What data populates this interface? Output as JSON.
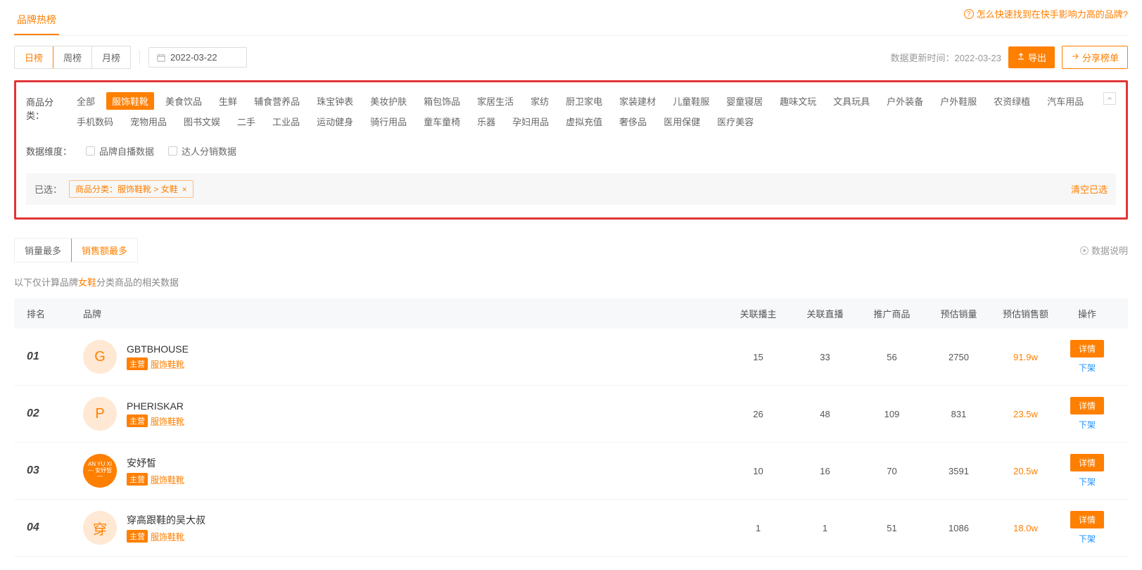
{
  "header": {
    "tab": "品牌热榜",
    "help": "怎么快速找到在快手影响力高的品牌?"
  },
  "toolbar": {
    "periods": [
      "日榜",
      "周榜",
      "月榜"
    ],
    "period_active_index": 0,
    "date": "2022-03-22",
    "update_prefix": "数据更新时间：",
    "update_time": "2022-03-23",
    "export": "导出",
    "share": "分享榜单"
  },
  "filters": {
    "category_label": "商品分类：",
    "category_active_index": 1,
    "categories": [
      "全部",
      "服饰鞋靴",
      "美食饮品",
      "生鲜",
      "辅食营养品",
      "珠宝钟表",
      "美妆护肤",
      "箱包饰品",
      "家居生活",
      "家纺",
      "厨卫家电",
      "家装建材",
      "儿童鞋服",
      "婴童寝居",
      "趣味文玩",
      "文具玩具",
      "户外装备",
      "户外鞋服",
      "农资绿植",
      "汽车用品",
      "手机数码",
      "宠物用品",
      "图书文娱",
      "二手",
      "工业品",
      "运动健身",
      "骑行用品",
      "童车童椅",
      "乐器",
      "孕妇用品",
      "虚拟充值",
      "奢侈品",
      "医用保健",
      "医疗美容"
    ],
    "dim_label": "数据维度：",
    "dim_options": [
      "品牌自播数据",
      "达人分销数据"
    ],
    "selected_label": "已选：",
    "selected_chip": "商品分类：服饰鞋靴 > 女鞋",
    "clear": "清空已选"
  },
  "sort": {
    "tabs": [
      "销量最多",
      "销售额最多"
    ],
    "active_index": 1,
    "data_desc": "数据说明"
  },
  "note": {
    "pre": "以下仅计算品牌",
    "hl": "女鞋",
    "post": "分类商品的相关数据"
  },
  "table": {
    "headers": {
      "rank": "排名",
      "brand": "品牌",
      "broadcaster": "关联播主",
      "live": "关联直播",
      "product": "推广商品",
      "volume": "预估销量",
      "sales": "预估销售额",
      "action": "操作"
    },
    "tag_main": "主营",
    "tag_cat": "服饰鞋靴",
    "btn_detail": "详情",
    "link_off": "下架",
    "rows": [
      {
        "rank": "01",
        "logo": "G",
        "logo_class": "",
        "name": "GBTBHOUSE",
        "broadcaster": "15",
        "live": "33",
        "product": "56",
        "volume": "2750",
        "sales": "91.9w"
      },
      {
        "rank": "02",
        "logo": "P",
        "logo_class": "",
        "name": "PHERISKAR",
        "broadcaster": "26",
        "live": "48",
        "product": "109",
        "volume": "831",
        "sales": "23.5w"
      },
      {
        "rank": "03",
        "logo": "AN YU XI\n— 安妤皙 —",
        "logo_class": "al3",
        "name": "安妤皙",
        "broadcaster": "10",
        "live": "16",
        "product": "70",
        "volume": "3591",
        "sales": "20.5w"
      },
      {
        "rank": "04",
        "logo": "穿",
        "logo_class": "",
        "name": "穿高跟鞋的吴大叔",
        "broadcaster": "1",
        "live": "1",
        "product": "51",
        "volume": "1086",
        "sales": "18.0w"
      }
    ]
  }
}
